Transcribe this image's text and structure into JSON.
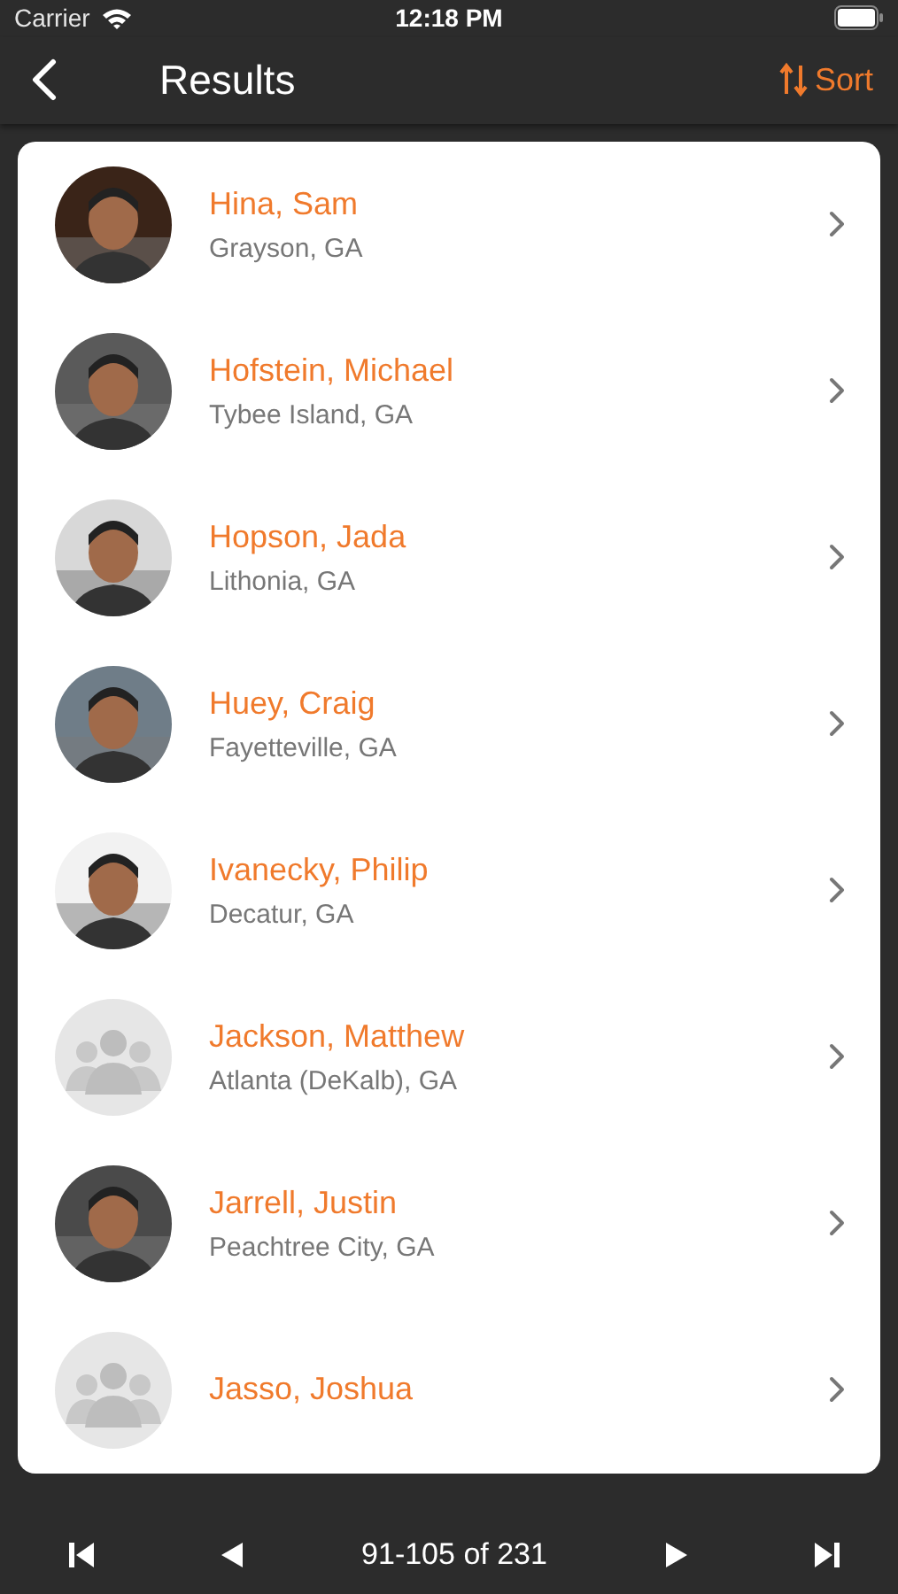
{
  "status_bar": {
    "carrier": "Carrier",
    "time": "12:18 PM"
  },
  "nav": {
    "title": "Results",
    "sort_label": "Sort"
  },
  "results": [
    {
      "name": "Hina, Sam",
      "location": "Grayson, GA"
    },
    {
      "name": "Hofstein, Michael",
      "location": "Tybee Island, GA"
    },
    {
      "name": "Hopson, Jada",
      "location": "Lithonia, GA"
    },
    {
      "name": "Huey, Craig",
      "location": "Fayetteville, GA"
    },
    {
      "name": "Ivanecky, Philip",
      "location": "Decatur, GA"
    },
    {
      "name": "Jackson, Matthew",
      "location": "Atlanta (DeKalb), GA",
      "avatar": {
        "kind": "placeholder"
      }
    },
    {
      "name": "Jarrell, Justin",
      "location": "Peachtree City, GA"
    },
    {
      "name": "Jasso, Joshua",
      "avatar": {
        "kind": "placeholder"
      }
    }
  ],
  "pager": {
    "range": "91-105 of 231"
  }
}
